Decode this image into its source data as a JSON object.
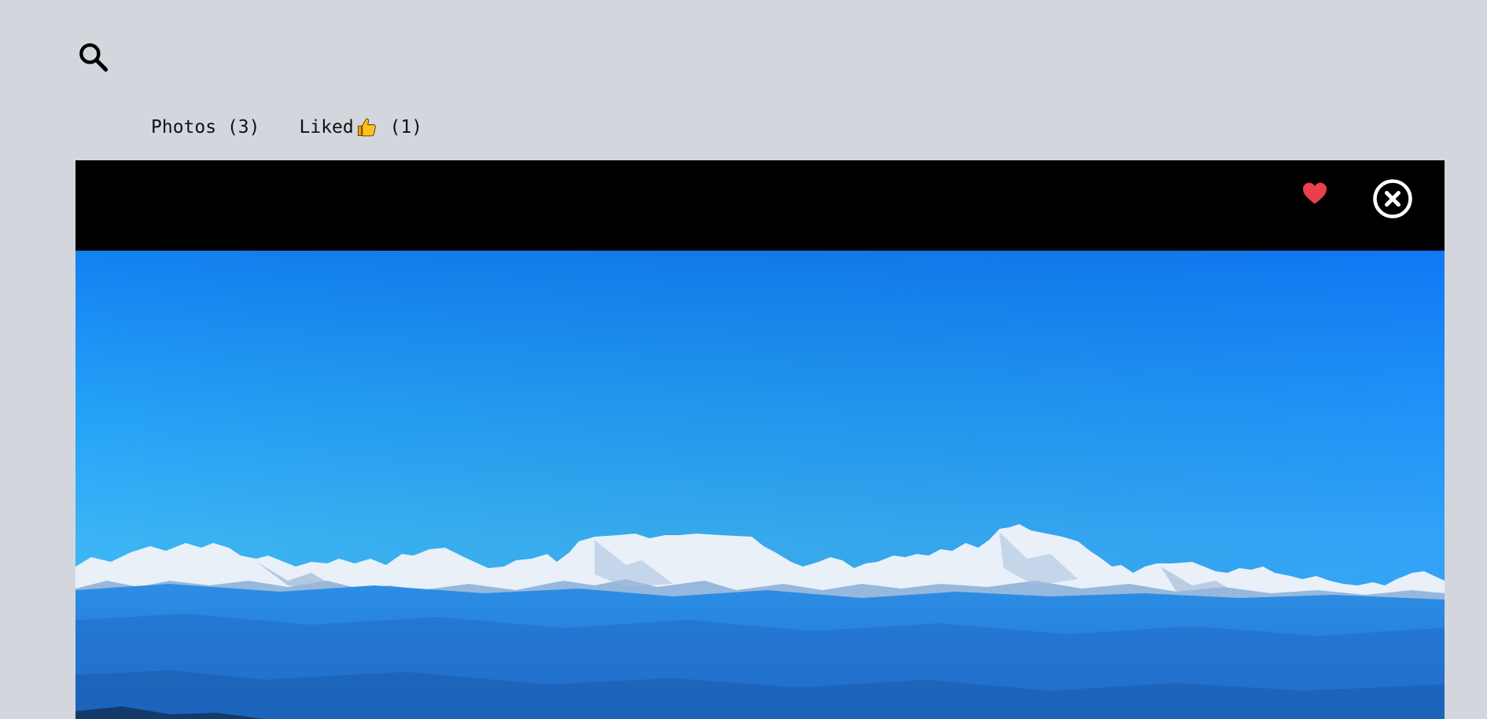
{
  "icons": {
    "search": "search-icon",
    "like": "heart-icon",
    "close": "close-circle-icon",
    "thumb": "thumbs-up-icon"
  },
  "tabs": [
    {
      "label": "Photos",
      "count": "(3)"
    },
    {
      "label": "Liked",
      "count": "(1)"
    }
  ],
  "viewer": {
    "like_color": "#e8414b",
    "close_color": "#ffffff"
  }
}
